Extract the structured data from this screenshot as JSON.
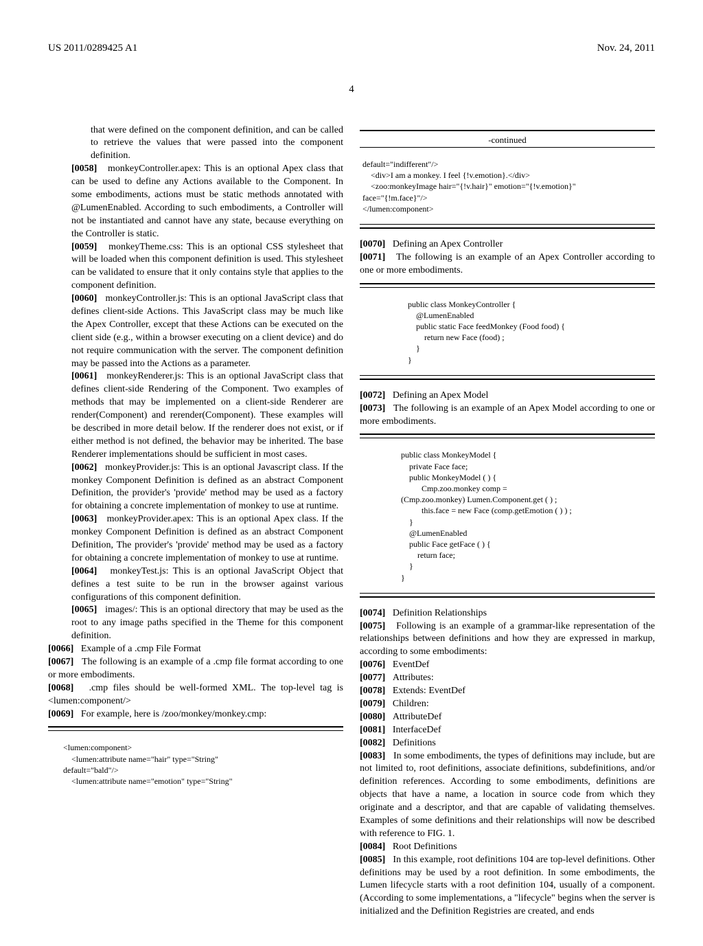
{
  "header": {
    "pub_number": "US 2011/0289425 A1",
    "date": "Nov. 24, 2011"
  },
  "page_number": "4",
  "col1": {
    "intro_cont": "that were defined on the component definition, and can be called to retrieve the values that were passed into the component definition.",
    "p58_num": "[0058]",
    "p58": "monkeyController.apex: This is an optional Apex class that can be used to define any Actions available to the Component. In some embodiments, actions must be static methods annotated with @LumenEnabled. According to such embodiments, a Controller will not be instantiated and cannot have any state, because everything on the Controller is static.",
    "p59_num": "[0059]",
    "p59": "monkeyTheme.css: This is an optional CSS stylesheet that will be loaded when this component definition is used. This stylesheet can be validated to ensure that it only contains style that applies to the component definition.",
    "p60_num": "[0060]",
    "p60": "monkeyController.js: This is an optional JavaScript class that defines client-side Actions. This JavaScript class may be much like the Apex Controller, except that these Actions can be executed on the client side (e.g., within a browser executing on a client device) and do not require communication with the server. The component definition may be passed into the Actions as a parameter.",
    "p61_num": "[0061]",
    "p61": "monkeyRenderer.js: This is an optional JavaScript class that defines client-side Rendering of the Component. Two examples of methods that may be implemented on a client-side Renderer are render(Component) and rerender(Component). These examples will be described in more detail below. If the renderer does not exist, or if either method is not defined, the behavior may be inherited. The base Renderer implementations should be sufficient in most cases.",
    "p62_num": "[0062]",
    "p62": "monkeyProvider.js: This is an optional Javascript class. If the monkey Component Definition is defined as an abstract Component Definition, the provider's 'provide' method may be used as a factory for obtaining a concrete implementation of monkey to use at runtime.",
    "p63_num": "[0063]",
    "p63": "monkeyProvider.apex: This is an optional Apex class. If the monkey Component Definition is defined as an abstract Component Definition, The provider's 'provide' method may be used as a factory for obtaining a concrete implementation of monkey to use at runtime.",
    "p64_num": "[0064]",
    "p64": "monkeyTest.js: This is an optional JavaScript Object that defines a test suite to be run in the browser against various configurations of this component definition.",
    "p65_num": "[0065]",
    "p65": "images/: This is an optional directory that may be used as the root to any image paths specified in the Theme for this component definition.",
    "p66_num": "[0066]",
    "p66": "Example of a .cmp File Format",
    "p67_num": "[0067]",
    "p67": "The following is an example of a .cmp file format according to one or more embodiments.",
    "p68_num": "[0068]",
    "p68": ".cmp files should be well-formed XML. The top-level tag is <lumen:component/>",
    "p69_num": "[0069]",
    "p69": "For example, here is /zoo/monkey/monkey.cmp:",
    "code1": "<lumen:component>\n    <lumen:attribute name=\"hair\" type=\"String\"\ndefault=\"bald\"/>\n    <lumen:attribute name=\"emotion\" type=\"String\""
  },
  "col2": {
    "continued_label": "-continued",
    "code1b": "default=\"indifferent\"/>\n    <div>I am a monkey. I feel {!v.emotion}.</div>\n    <zoo:monkeyImage hair=\"{!v.hair}\" emotion=\"{!v.emotion}\"\nface=\"{!m.face}\"/>\n</lumen:component>",
    "p70_num": "[0070]",
    "p70": "Defining an Apex Controller",
    "p71_num": "[0071]",
    "p71": "The following is an example of an Apex Controller according to one or more embodiments.",
    "code2": "public class MonkeyController {\n    @LumenEnabled\n    public static Face feedMonkey (Food food) {\n        return new Face (food) ;\n    }\n}",
    "p72_num": "[0072]",
    "p72": "Defining an Apex Model",
    "p73_num": "[0073]",
    "p73": "The following is an example of an Apex Model according to one or more embodiments.",
    "code3": "public class MonkeyModel {\n    private Face face;\n    public MonkeyModel ( ) {\n          Cmp.zoo.monkey comp =\n(Cmp.zoo.monkey) Lumen.Component.get ( ) ;\n          this.face = new Face (comp.getEmotion ( ) ) ;\n    }\n    @LumenEnabled\n    public Face getFace ( ) {\n        return face;\n    }\n}",
    "p74_num": "[0074]",
    "p74": "Definition Relationships",
    "p75_num": "[0075]",
    "p75": "Following is an example of a grammar-like representation of the relationships between definitions and how they are expressed in markup, according to some embodiments:",
    "p76_num": "[0076]",
    "p76": "EventDef",
    "p77_num": "[0077]",
    "p77": "Attributes:",
    "p78_num": "[0078]",
    "p78": "Extends: EventDef",
    "p79_num": "[0079]",
    "p79": "Children:",
    "p80_num": "[0080]",
    "p80": "AttributeDef",
    "p81_num": "[0081]",
    "p81": "InterfaceDef",
    "p82_num": "[0082]",
    "p82": "Definitions",
    "p83_num": "[0083]",
    "p83": "In some embodiments, the types of definitions may include, but are not limited to, root definitions, associate definitions, subdefinitions, and/or definition references. According to some embodiments, definitions are objects that have a name, a location in source code from which they originate and a descriptor, and that are capable of validating themselves. Examples of some definitions and their relationships will now be described with reference to FIG. 1.",
    "p84_num": "[0084]",
    "p84": "Root Definitions",
    "p85_num": "[0085]",
    "p85": "In this example, root definitions 104 are top-level definitions. Other definitions may be used by a root definition. In some embodiments, the Lumen lifecycle starts with a root definition 104, usually of a component. (According to some implementations, a \"lifecycle\" begins when the server is initialized and the Definition Registries are created, and ends"
  }
}
